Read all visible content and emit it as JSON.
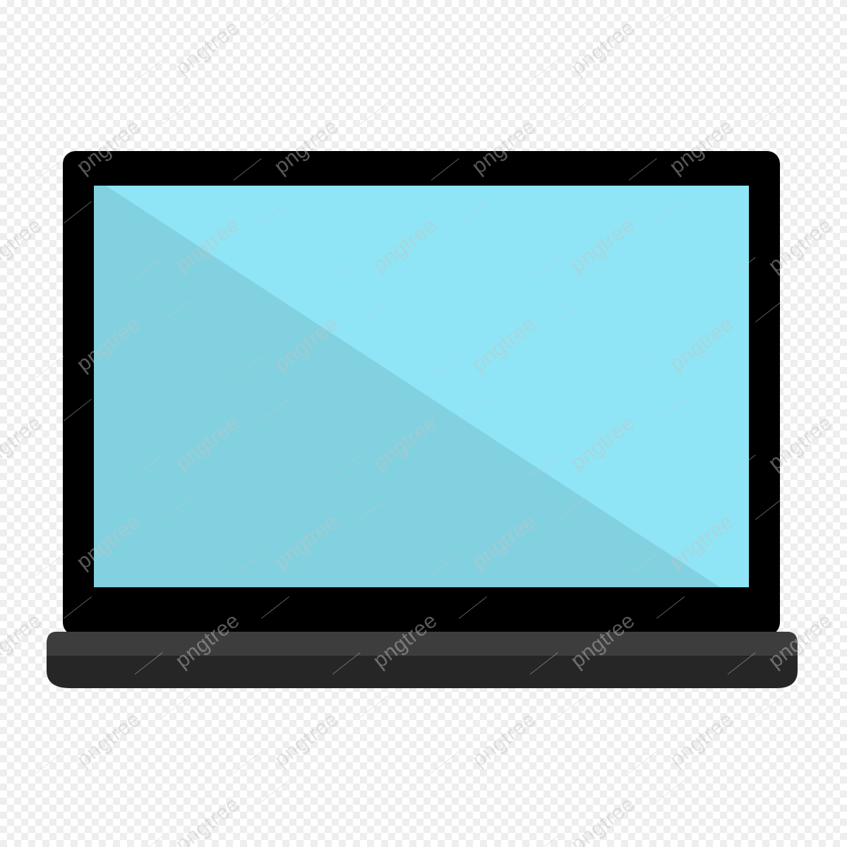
{
  "illustration": {
    "subject": "laptop-icon",
    "colors": {
      "bezel": "#000000",
      "screen_light": "#8fe5f5",
      "screen_shade": "#82d1e0",
      "base_top": "#3d3d3d",
      "base_bottom": "#262626",
      "checker_light": "#ffffff",
      "checker_dark": "#eeeeee"
    }
  },
  "watermark": {
    "text": "pngtree",
    "color": "#c4c4c4"
  }
}
